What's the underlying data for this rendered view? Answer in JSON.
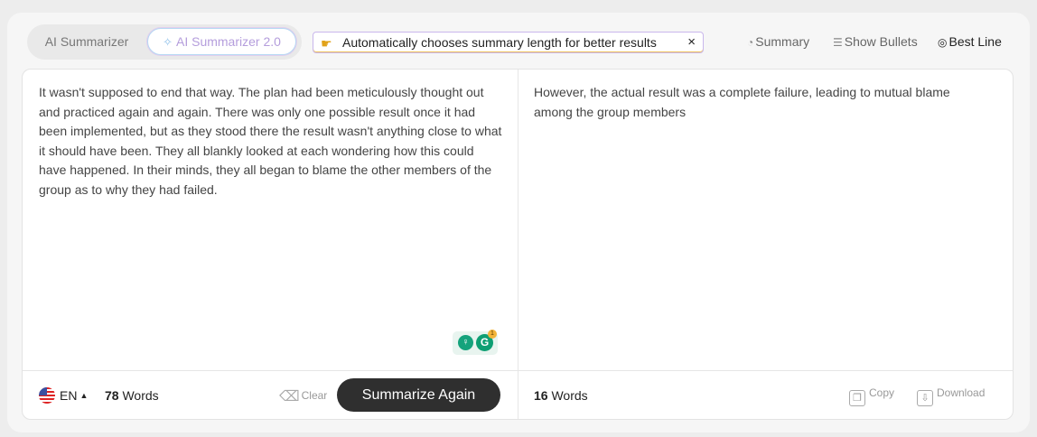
{
  "modes": {
    "tab1": "AI Summarizer",
    "tab2": "AI Summarizer 2.0"
  },
  "tip": {
    "text": "Automatically chooses summary length for better results",
    "close": "×"
  },
  "options": {
    "summary": "Summary",
    "bullets": "Show Bullets",
    "best_line": "Best Line"
  },
  "input": {
    "text": "It wasn't supposed to end that way. The plan had been meticulously thought out and practiced again and again. There was only one possible result once it had been implemented, but as they stood there the result wasn't anything close to what it should have been. They all blankly looked at each wondering how this could have happened. In their minds, they all began to blame the other members of the group as to why they had failed.",
    "language": "EN",
    "word_count": "78",
    "words_label": "Words",
    "clear_label": "Clear",
    "button_label": "Summarize Again",
    "grammarly_count": "1"
  },
  "output": {
    "text": "However, the actual result was a complete failure, leading to mutual blame among the group members",
    "word_count": "16",
    "words_label": "Words",
    "copy_label": "Copy",
    "download_label": "Download"
  }
}
